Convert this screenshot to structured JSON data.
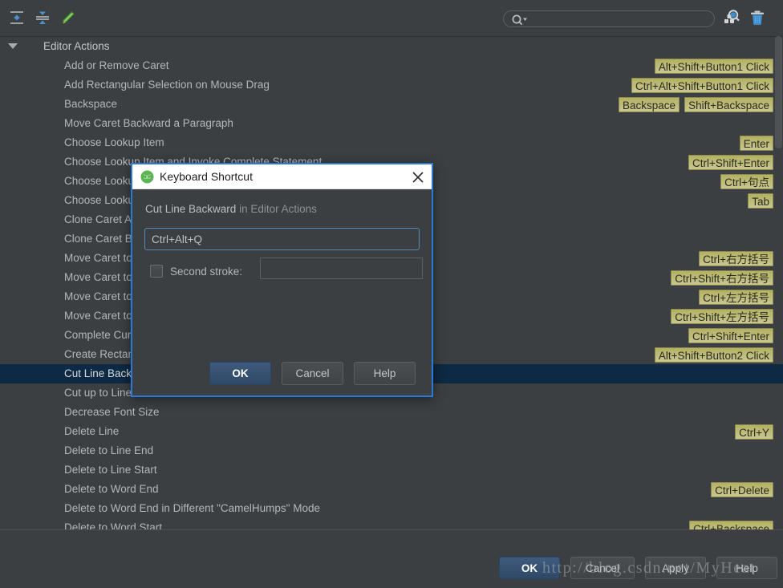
{
  "toolbar": {
    "expand_all_icon": "expand-all-icon",
    "collapse_all_icon": "collapse-all-icon",
    "edit_icon": "pencil-edit-icon",
    "find_shortcut_icon": "find-by-shortcut-icon",
    "delete_icon": "trash-delete-icon",
    "search_value": "",
    "search_placeholder": ""
  },
  "tree": {
    "group_label": "Editor Actions",
    "rows": [
      {
        "label": "Add or Remove Caret",
        "indent": "child",
        "shortcuts": [
          "Alt+Shift+Button1 Click"
        ]
      },
      {
        "label": "Add Rectangular Selection on Mouse Drag",
        "indent": "child",
        "shortcuts": [
          "Ctrl+Alt+Shift+Button1 Click"
        ]
      },
      {
        "label": "Backspace",
        "indent": "child",
        "shortcuts": [
          "Backspace",
          "Shift+Backspace"
        ]
      },
      {
        "label": "Move Caret Backward a Paragraph",
        "indent": "child",
        "shortcuts": []
      },
      {
        "label": "Choose Lookup Item",
        "indent": "child",
        "shortcuts": [
          "Enter"
        ]
      },
      {
        "label": "Choose Lookup Item and Invoke Complete Statement",
        "indent": "child",
        "shortcuts": [
          "Ctrl+Shift+Enter"
        ]
      },
      {
        "label": "Choose Lookup Item Replace",
        "indent": "child",
        "shortcuts": [
          "Ctrl+句点"
        ]
      },
      {
        "label": "Choose Lookup Item Dot",
        "indent": "child",
        "shortcuts": [
          "Tab"
        ]
      },
      {
        "label": "Clone Caret Above",
        "indent": "child",
        "shortcuts": []
      },
      {
        "label": "Clone Caret Below",
        "indent": "child",
        "shortcuts": []
      },
      {
        "label": "Move Caret to Code Block End",
        "indent": "child",
        "shortcuts": [
          "Ctrl+右方括号"
        ]
      },
      {
        "label": "Move Caret to Code Block End with Selection",
        "indent": "child",
        "shortcuts": [
          "Ctrl+Shift+右方括号"
        ]
      },
      {
        "label": "Move Caret to Code Block Start",
        "indent": "child",
        "shortcuts": [
          "Ctrl+左方括号"
        ]
      },
      {
        "label": "Move Caret to Code Block Start with Selection",
        "indent": "child",
        "shortcuts": [
          "Ctrl+Shift+左方括号"
        ]
      },
      {
        "label": "Complete Current Statement",
        "indent": "child",
        "shortcuts": [
          "Ctrl+Shift+Enter"
        ]
      },
      {
        "label": "Create Rectangular Selection",
        "indent": "child",
        "shortcuts": [
          "Alt+Shift+Button2 Click"
        ]
      },
      {
        "label": "Cut Line Backward",
        "indent": "child",
        "shortcuts": [],
        "selected": true
      },
      {
        "label": "Cut up to Line End",
        "indent": "child",
        "shortcuts": []
      },
      {
        "label": "Decrease Font Size",
        "indent": "child",
        "shortcuts": []
      },
      {
        "label": "Delete Line",
        "indent": "child",
        "shortcuts": [
          "Ctrl+Y"
        ]
      },
      {
        "label": "Delete to Line End",
        "indent": "child",
        "shortcuts": []
      },
      {
        "label": "Delete to Line Start",
        "indent": "child",
        "shortcuts": []
      },
      {
        "label": "Delete to Word End",
        "indent": "child",
        "shortcuts": [
          "Ctrl+Delete"
        ]
      },
      {
        "label": "Delete to Word End in Different \"CamelHumps\" Mode",
        "indent": "child",
        "shortcuts": []
      },
      {
        "label": "Delete to Word Start",
        "indent": "child",
        "shortcuts": [
          "Ctrl+Backspace"
        ]
      }
    ]
  },
  "dialog": {
    "title": "Keyboard Shortcut",
    "app_icon": "android-studio-icon",
    "close_icon": "close-icon",
    "action_name": "Cut Line Backward",
    "action_context": "in Editor Actions",
    "first_stroke_value": "Ctrl+Alt+Q",
    "first_stroke_placeholder": "",
    "second_stroke_label": "Second stroke:",
    "second_stroke_checked": false,
    "second_stroke_value": "",
    "second_stroke_placeholder": "",
    "ok_label": "OK",
    "cancel_label": "Cancel",
    "help_label": "Help"
  },
  "bottom_bar": {
    "ok_label": "OK",
    "cancel_label": "Cancel",
    "apply_label": "Apply",
    "help_label": "Help"
  },
  "watermark": {
    "text": "http://blog.csdn.net/MyHeat"
  },
  "colors": {
    "background": "#3c3f41",
    "selection": "#0d2943",
    "badge_bg": "#bdba78",
    "dialog_border": "#2b79d4",
    "primary_button": "#3f5b7d",
    "text": "#b4b7ba"
  }
}
